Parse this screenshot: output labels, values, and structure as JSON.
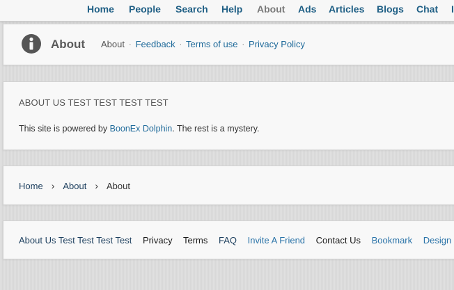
{
  "topnav": {
    "items": [
      {
        "label": "Home"
      },
      {
        "label": "People"
      },
      {
        "label": "Search"
      },
      {
        "label": "Help"
      },
      {
        "label": "About"
      },
      {
        "label": "Ads"
      },
      {
        "label": "Articles"
      },
      {
        "label": "Blogs"
      },
      {
        "label": "Chat"
      },
      {
        "label": "I"
      }
    ],
    "active": "About"
  },
  "header": {
    "icon": "info-icon",
    "title": "About",
    "submenu": {
      "current": "About",
      "separator": "·",
      "links": [
        "Feedback",
        "Terms of use",
        "Privacy Policy"
      ]
    }
  },
  "content": {
    "heading": "ABOUT US TEST TEST TEST TEST",
    "text_before": "This site is powered by ",
    "link": "BoonEx Dolphin",
    "text_after": ". The rest is a mystery."
  },
  "breadcrumb": {
    "items": [
      "Home",
      "About",
      "About"
    ],
    "separator": "›"
  },
  "footer": {
    "links": [
      "About Us Test Test Test Test",
      "Privacy",
      "Terms",
      "FAQ",
      "Invite A Friend",
      "Contact Us",
      "Bookmark",
      "Design ("
    ]
  },
  "colors": {
    "link": "#1f6a9a",
    "nav": "#1f5f85",
    "nav_active": "#7a7a7a",
    "background": "#dcdcdc",
    "card": "#f8f8f8"
  }
}
